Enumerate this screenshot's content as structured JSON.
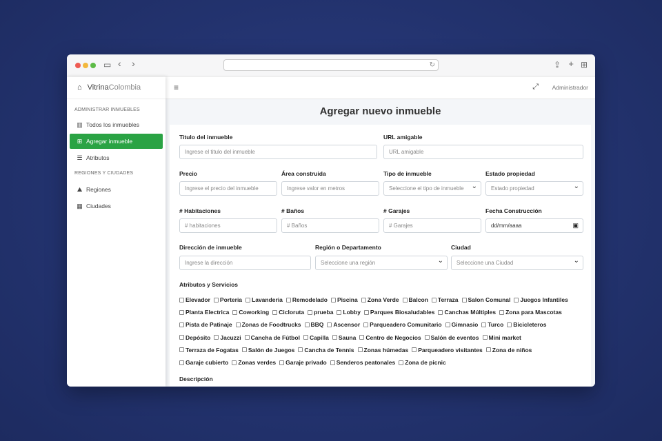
{
  "browser": {
    "address_value": "",
    "icons": [
      "sidebar-toggle-icon",
      "back-icon",
      "forward-icon",
      "reload-icon",
      "share-icon",
      "new-tab-icon",
      "tabs-overview-icon"
    ]
  },
  "sidebar": {
    "brand": {
      "part1": "Vitrina",
      "part2": "Colombia"
    },
    "section1": "ADMINISTRAR INMUEBLES",
    "section2": "REGIONES Y CIUDADES",
    "items": [
      {
        "label": "Todos los inmuebles",
        "icon": "building-icon"
      },
      {
        "label": "Agregar inmueble",
        "icon": "plus-square-icon",
        "active": true
      },
      {
        "label": "Atributos",
        "icon": "list-icon"
      },
      {
        "label": "Regiones",
        "icon": "map-icon"
      },
      {
        "label": "Ciudades",
        "icon": "city-icon"
      }
    ]
  },
  "topnav": {
    "user": "Administrador"
  },
  "page": {
    "title": "Agregar nuevo inmueble"
  },
  "form": {
    "titulo": {
      "label": "Titulo del inmueble",
      "placeholder": "Ingrese el titulo del inmueble"
    },
    "url": {
      "label": "URL amigable",
      "placeholder": "URL amigable"
    },
    "precio": {
      "label": "Precio",
      "placeholder": "Ingrese el precio del inmueble"
    },
    "area": {
      "label": "Área construida",
      "placeholder": "Ingrese valor en metros"
    },
    "tipo": {
      "label": "Tipo de inmueble",
      "value": "Seleccione el tipo de inmueble"
    },
    "estado": {
      "label": "Estado propiedad",
      "value": "Estado propiedad"
    },
    "habitaciones": {
      "label": "# Habitaciones",
      "placeholder": "# habitaciones"
    },
    "banos": {
      "label": "# Baños",
      "placeholder": "# Baños"
    },
    "garajes": {
      "label": "# Garajes",
      "placeholder": "# Garajes"
    },
    "fecha": {
      "label": "Fecha Construcción",
      "placeholder": "dd/mm/aaaa"
    },
    "direccion": {
      "label": "Dirección de inmueble",
      "placeholder": "Ingrese la dirección"
    },
    "region": {
      "label": "Región o Departamento",
      "value": "Seleccione una región"
    },
    "ciudad": {
      "label": "Ciudad",
      "value": "Seleccione una Ciudad"
    },
    "atributos_label": "Atributos y Servicios",
    "descripcion_label": "Descripción",
    "attribute_rows": [
      [
        "Elevador",
        "Porteria",
        "Lavanderia",
        "Remodelado",
        "Piscina",
        "Zona Verde",
        "Balcon",
        "Terraza",
        "Salon Comunal",
        "Juegos Infantiles"
      ],
      [
        "Planta Electrica",
        "Coworking",
        "Cicloruta",
        "prueba",
        "Lobby",
        "Parques Biosaludables",
        "Canchas Múltiples",
        "Zona para Mascotas"
      ],
      [
        "Pista de Patinaje",
        "Zonas de Foodtrucks",
        "BBQ",
        "Ascensor",
        "Parqueadero Comunitario",
        "Gimnasio",
        "Turco",
        "Bicicleteros"
      ],
      [
        "Depósito",
        "Jacuzzi",
        "Cancha de Fútbol",
        "Capilla",
        "Sauna",
        "Centro de Negocios",
        "Salón de eventos",
        "Mini market"
      ],
      [
        "Terraza de Fogatas",
        "Salón de Juegos",
        "Cancha de Tennis",
        "Zonas húmedas",
        "Parqueadero visitantes",
        "Zona de niños"
      ],
      [
        "Garaje cubierto",
        "Zonas verdes",
        "Garaje privado",
        "Senderos peatonales",
        "Zona de picnic"
      ]
    ]
  }
}
